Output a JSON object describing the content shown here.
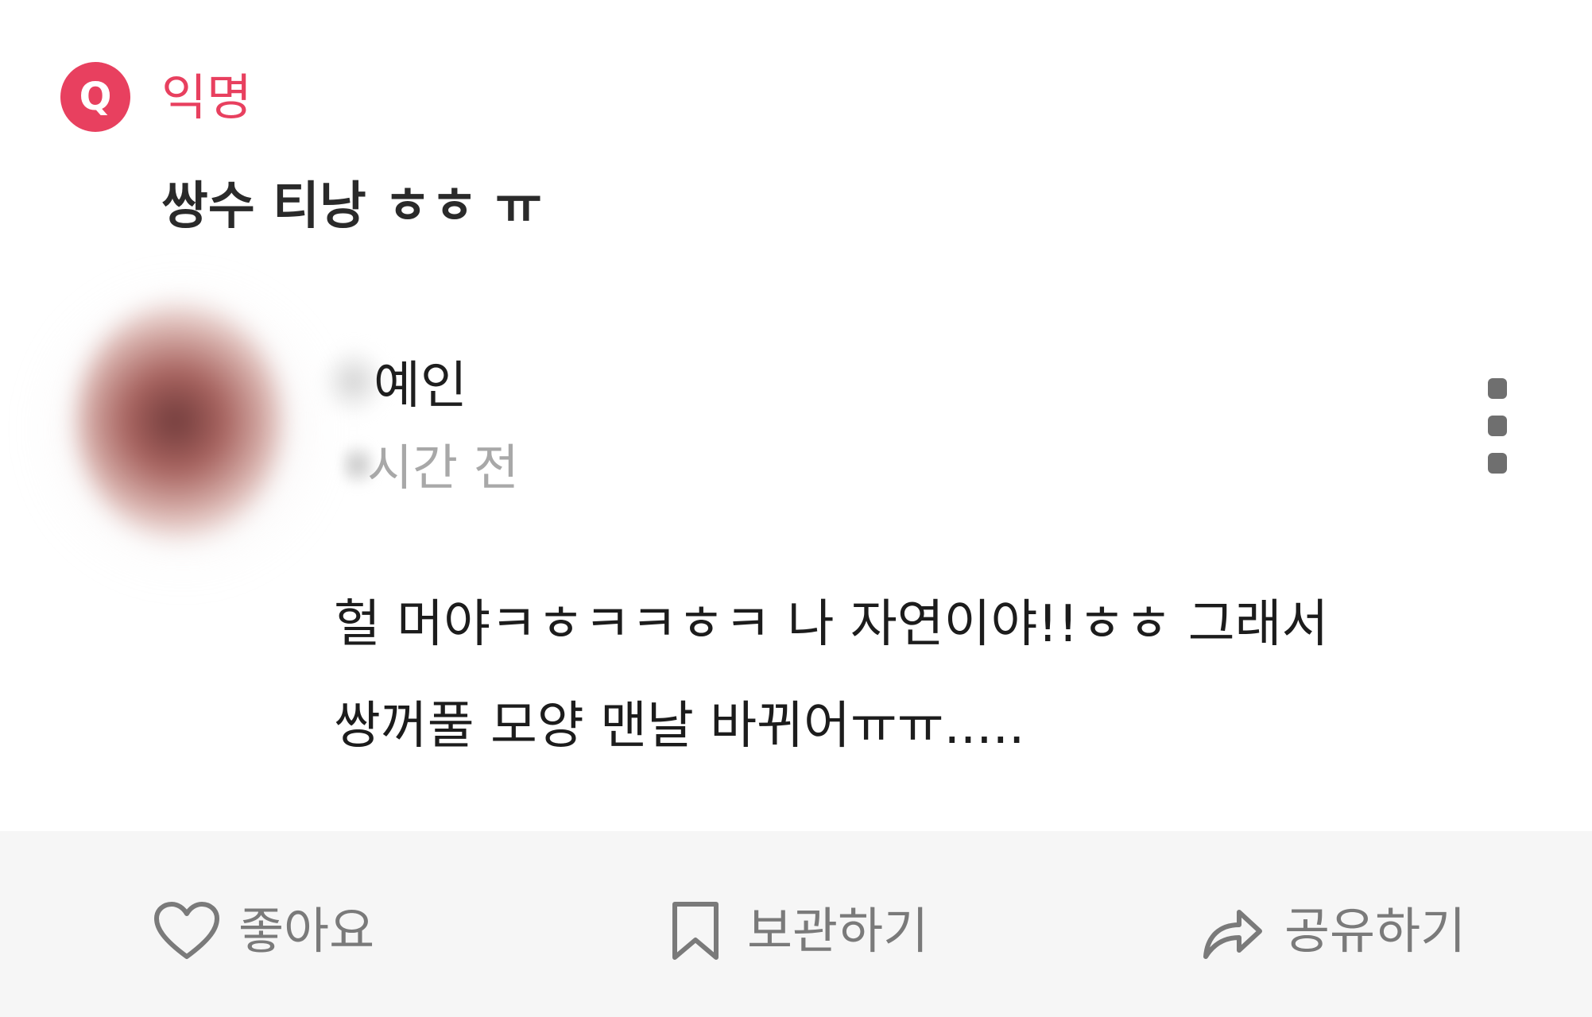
{
  "question": {
    "badge": "Q",
    "author": "익명",
    "text": "쌍수 티낭 ㅎㅎ ㅠ"
  },
  "answer": {
    "user_name": "예인",
    "time_ago": "시간 전",
    "lines": [
      "헐 머야ㅋㅎㅋㅋㅎㅋ 나 자연이야!!ㅎㅎ 그래서",
      "쌍꺼풀 모양 맨날 바뀌어ㅠㅠ....."
    ]
  },
  "actions": {
    "like_label": "좋아요",
    "bookmark_label": "보관하기",
    "share_label": "공유하기"
  },
  "colors": {
    "accent": "#e8405f",
    "action_bar": "#f6f6f6",
    "muted_text": "#a8a8a8"
  },
  "icons": {
    "badge": "q-icon",
    "menu": "more-vertical-icon",
    "like": "heart-icon",
    "bookmark": "bookmark-icon",
    "share": "share-arrow-icon"
  }
}
